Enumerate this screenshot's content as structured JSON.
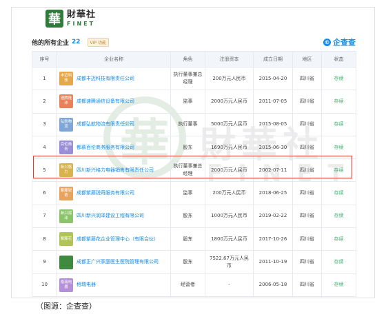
{
  "brand": {
    "mark_char": "華",
    "name_cn": "財華社",
    "name_en": "FINET"
  },
  "section": {
    "title": "他的所有企业",
    "count": "22",
    "vip_label": "VIP 功能",
    "source_logo_icon": "©",
    "source_logo_text": "企查查"
  },
  "table": {
    "headers": [
      "序号",
      "企业名称",
      "角色",
      "注册资本",
      "成立日期",
      "地区",
      "状态"
    ],
    "rows": [
      {
        "no": "1",
        "avatar": "丰迈科技",
        "avatar_color": "#e5a84b",
        "name": "成都丰迈科技有限责任公司",
        "role": "执行董事兼总经理",
        "capital": "200万元人民币",
        "date": "2015-04-20",
        "region": "四川省",
        "status": "存续"
      },
      {
        "no": "2",
        "avatar": "速腾隆沛",
        "avatar_color": "#e8825c",
        "name": "成都速腾通信设备有限公司",
        "role": "监事",
        "capital": "2000万元人民币",
        "date": "2011-07-05",
        "region": "四川省",
        "status": "存续"
      },
      {
        "no": "3",
        "avatar": "弘航物流",
        "avatar_color": "#7fa6d8",
        "name": "成都弘航物流有限责任公司",
        "role": "执行董事",
        "capital": "5000万元人民币",
        "date": "2015-08-05",
        "region": "四川省",
        "status": "存续"
      },
      {
        "no": "4",
        "avatar": "百伦商务",
        "avatar_color": "#9a8fd6",
        "name": "都慕百伦商务服务有限公司",
        "role": "股东",
        "capital": "1690万元人民币",
        "date": "2015-06-30",
        "region": "四川省",
        "status": "存续"
      },
      {
        "no": "5",
        "avatar": "新兴格力",
        "avatar_color": "#d8b24f",
        "name": "四川新兴格力电器销售有限责任公司",
        "role": "执行董事兼总经理",
        "capital": "2000万元人民币",
        "date": "2002-07-11",
        "region": "四川省",
        "status": "存续"
      },
      {
        "no": "6",
        "avatar": "紫藤锐奇",
        "avatar_color": "#e8a45c",
        "name": "成都紫藤锐奇服务有限公司",
        "role": "监事",
        "capital": "200万元人民币",
        "date": "2018-06-25",
        "region": "四川省",
        "status": "存续"
      },
      {
        "no": "7",
        "avatar": "新兴润泽",
        "avatar_color": "#8cc46b",
        "name": "四川新兴润泽建设工程有限公司",
        "role": "股东",
        "capital": "1000万元人民币",
        "date": "2019-02-22",
        "region": "四川省",
        "status": "存续"
      },
      {
        "no": "8",
        "avatar": "紫藤花",
        "avatar_color": "#b0c45a",
        "name": "成都紫藤花企业管理中心（有限合伙）",
        "role": "股东",
        "capital": "1800万元人民币",
        "date": "2017-10-26",
        "region": "四川省",
        "status": "存续"
      },
      {
        "no": "9",
        "avatar": "",
        "avatar_color": "#3f8a3f",
        "name": "成都正广兴家庭医生医院管理有限公司",
        "role": "股东",
        "capital": "7522.67万元人民币",
        "date": "2011-10-19",
        "region": "四川省",
        "status": "存续"
      },
      {
        "no": "10",
        "avatar": "格瑞电器",
        "avatar_color": "#b58fd8",
        "name": "格瑞电器",
        "role": "经营者",
        "capital": "-",
        "date": "2006-05-18",
        "region": "四川省",
        "status": "存续"
      }
    ]
  },
  "caption": "（图源：企查查）"
}
